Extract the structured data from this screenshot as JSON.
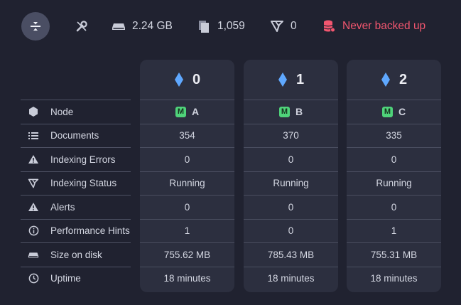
{
  "topbar": {
    "size_label": "2.24 GB",
    "docs_label": "1,059",
    "indexes_label": "0",
    "backup_label": "Never backed up",
    "danger_color": "#f2566f"
  },
  "rows": [
    {
      "label": "Node",
      "icon": "hexagon-icon"
    },
    {
      "label": "Documents",
      "icon": "list-icon"
    },
    {
      "label": "Indexing Errors",
      "icon": "warning-icon"
    },
    {
      "label": "Indexing Status",
      "icon": "index-icon"
    },
    {
      "label": "Alerts",
      "icon": "alert-icon"
    },
    {
      "label": "Performance Hints",
      "icon": "info-icon"
    },
    {
      "label": "Size on disk",
      "icon": "disk-icon"
    },
    {
      "label": "Uptime",
      "icon": "clock-icon"
    }
  ],
  "nodes": [
    {
      "number": "0",
      "badge": "M",
      "tag": "A",
      "documents": "354",
      "indexing_errors": "0",
      "indexing_status": "Running",
      "alerts": "0",
      "performance_hints": "1",
      "size_on_disk": "755.62 MB",
      "uptime": "18 minutes"
    },
    {
      "number": "1",
      "badge": "M",
      "tag": "B",
      "documents": "370",
      "indexing_errors": "0",
      "indexing_status": "Running",
      "alerts": "0",
      "performance_hints": "0",
      "size_on_disk": "785.43 MB",
      "uptime": "18 minutes"
    },
    {
      "number": "2",
      "badge": "M",
      "tag": "C",
      "documents": "335",
      "indexing_errors": "0",
      "indexing_status": "Running",
      "alerts": "0",
      "performance_hints": "1",
      "size_on_disk": "755.31 MB",
      "uptime": "18 minutes"
    }
  ],
  "colors": {
    "accent_diamond": "#5fa8ff",
    "member_badge": "#4fd37a"
  }
}
